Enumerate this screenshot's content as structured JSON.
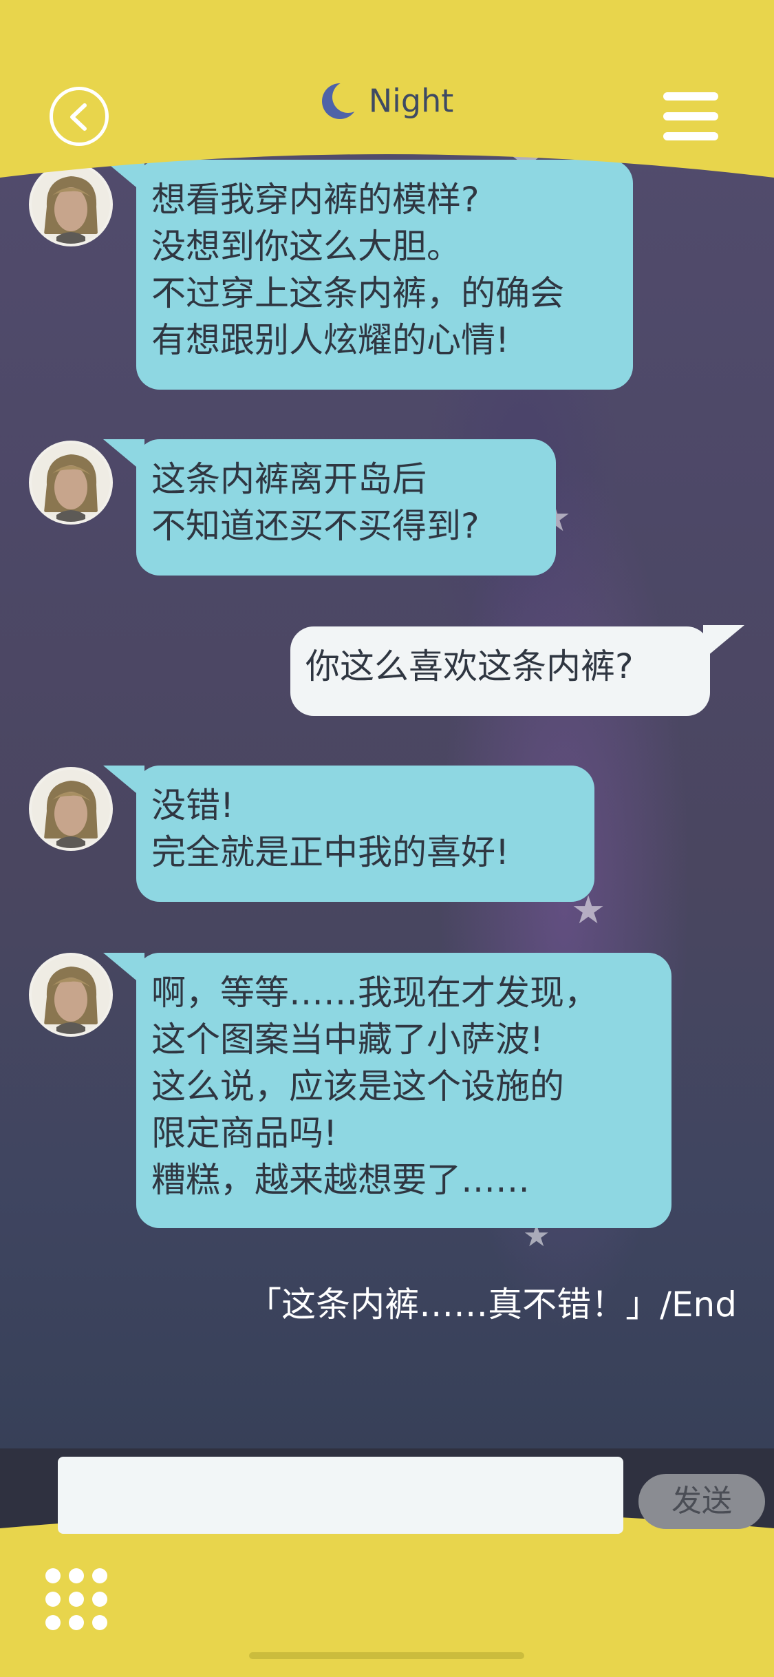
{
  "header": {
    "title": "Night",
    "back_icon": "back-chevron-icon",
    "moon_icon": "crescent-moon-icon",
    "menu_icon": "hamburger-menu-icon"
  },
  "messages": [
    {
      "sender": "character",
      "text": "想看我穿内裤的模样?\n没想到你这么大胆。\n不过穿上这条内裤，的确会\n有想跟别人炫耀的心情!"
    },
    {
      "sender": "character",
      "text": "这条内裤离开岛后\n不知道还买不买得到?"
    },
    {
      "sender": "player",
      "text": "你这么喜欢这条内裤?"
    },
    {
      "sender": "character",
      "text": "没错!\n完全就是正中我的喜好!"
    },
    {
      "sender": "character",
      "text": "啊，等等……我现在才发现，\n这个图案当中藏了小萨波!\n这么说，应该是这个设施的\n限定商品吗!\n糟糕，越来越想要了……"
    }
  ],
  "end_line": "「这条内裤……真不错！」/End",
  "input": {
    "value": "",
    "placeholder": ""
  },
  "send_label": "发送",
  "bottom_menu_icon": "grid-dots-icon",
  "colors": {
    "header_bg": "#e8d54c",
    "incoming_bubble": "#8ed7e2",
    "outgoing_bubble": "#f2f5f6",
    "chat_bg": "#4d4867"
  }
}
